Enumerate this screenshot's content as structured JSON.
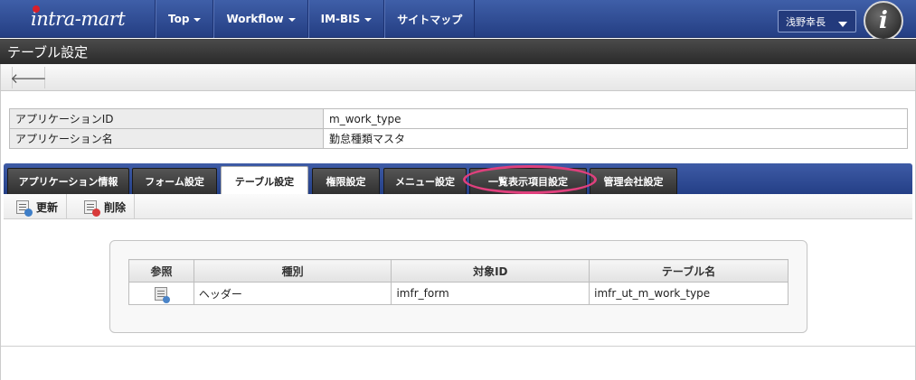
{
  "header": {
    "logo": "intra-mart",
    "nav": [
      {
        "label": "Top",
        "dropdown": true
      },
      {
        "label": "Workflow",
        "dropdown": true
      },
      {
        "label": "IM-BIS",
        "dropdown": true
      },
      {
        "label": "サイトマップ",
        "dropdown": false
      }
    ],
    "user_name": "浅野幸長",
    "avatar_letter": "i"
  },
  "page_title": "テーブル設定",
  "toolbar": {
    "back_icon": "arrow-left-icon"
  },
  "info_table": [
    {
      "key": "アプリケーションID",
      "value": "m_work_type"
    },
    {
      "key": "アプリケーション名",
      "value": "勤怠種類マスタ"
    }
  ],
  "tabs": [
    {
      "label": "アプリケーション情報",
      "active": false
    },
    {
      "label": "フォーム設定",
      "active": false
    },
    {
      "label": "テーブル設定",
      "active": true
    },
    {
      "label": "権限設定",
      "active": false
    },
    {
      "label": "メニュー設定",
      "active": false
    },
    {
      "label": "一覧表示項目設定",
      "active": false,
      "highlighted": true
    },
    {
      "label": "管理会社設定",
      "active": false
    }
  ],
  "actions": {
    "update": "更新",
    "delete": "削除"
  },
  "grid": {
    "headers": [
      "参照",
      "種別",
      "対象ID",
      "テーブル名"
    ],
    "rows": [
      {
        "ref_icon": "document-icon",
        "kind": "ヘッダー",
        "target_id": "imfr_form",
        "table_name": "imfr_ut_m_work_type"
      }
    ]
  },
  "colors": {
    "nav_blue": "#2f4c96",
    "highlight": "#e0407d",
    "title_bar": "#333333"
  }
}
